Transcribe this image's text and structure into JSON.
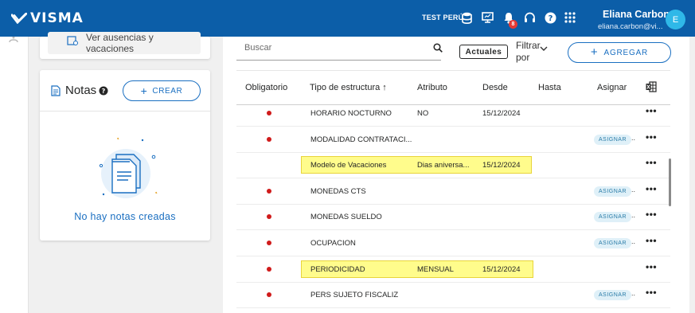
{
  "topbar": {
    "brand": "VISMA",
    "environment": "TEST PERÚ",
    "notification_count": "8",
    "user_name": "Eliana Carbon",
    "user_email": "eliana.carbon@vi...",
    "avatar_initial": "E",
    "icons": [
      "database-icon",
      "monitor-icon",
      "bell-icon",
      "headset-icon",
      "help-icon",
      "apps-grid-icon"
    ]
  },
  "left": {
    "ausencias_label": "Ver ausencias y vacaciones",
    "notas_title": "Notas",
    "crear_label": "CREAR",
    "empty_text": "No hay notas creadas"
  },
  "toolbar": {
    "search_placeholder": "Buscar",
    "chip_label": "Actuales",
    "filter_label": "Filtrar por",
    "add_label": "AGREGAR"
  },
  "table": {
    "columns": [
      "Obligatorio",
      "Tipo de estructura ↑",
      "Atributo",
      "Desde",
      "Hasta",
      "Asignar"
    ],
    "asignar_label": "ASIGNAR",
    "asignar_suffix": "..",
    "more_label": "•••",
    "rows": [
      {
        "obligatorio": true,
        "tipo": "HORARIO NOCTURNO",
        "atributo": "NO",
        "desde": "15/12/2024",
        "hasta": "",
        "asignar": false,
        "highlight": false
      },
      {
        "obligatorio": true,
        "tipo": "MODALIDAD CONTRATACI...",
        "atributo": "",
        "desde": "",
        "hasta": "",
        "asignar": true,
        "highlight": false
      },
      {
        "obligatorio": false,
        "tipo": "Modelo de Vacaciones",
        "atributo": "Dias aniversa...",
        "desde": "15/12/2024",
        "hasta": "",
        "asignar": false,
        "highlight": true
      },
      {
        "obligatorio": true,
        "tipo": "MONEDAS CTS",
        "atributo": "",
        "desde": "",
        "hasta": "",
        "asignar": true,
        "highlight": false
      },
      {
        "obligatorio": true,
        "tipo": "MONEDAS SUELDO",
        "atributo": "",
        "desde": "",
        "hasta": "",
        "asignar": true,
        "highlight": false
      },
      {
        "obligatorio": true,
        "tipo": "OCUPACION",
        "atributo": "",
        "desde": "",
        "hasta": "",
        "asignar": true,
        "highlight": false
      },
      {
        "obligatorio": true,
        "tipo": "PERIODICIDAD",
        "atributo": "MENSUAL",
        "desde": "15/12/2024",
        "hasta": "",
        "asignar": false,
        "highlight": true
      },
      {
        "obligatorio": true,
        "tipo": "PERS SUJETO FISCALIZ",
        "atributo": "",
        "desde": "",
        "hasta": "",
        "asignar": true,
        "highlight": false
      }
    ]
  },
  "colors": {
    "brand_blue": "#0c5ea8",
    "accent_blue": "#1a6fc1",
    "required_dot": "#d01b1b",
    "highlight": "#fffc8c"
  }
}
